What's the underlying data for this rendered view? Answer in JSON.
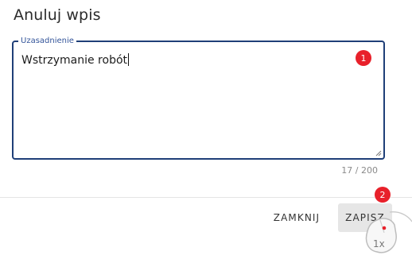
{
  "dialog": {
    "title": "Anuluj wpis"
  },
  "field": {
    "label": "Uzasadnienie",
    "value": "Wstrzymanie robót",
    "counter": "17 / 200"
  },
  "actions": {
    "close_label": "ZAMKNIJ",
    "save_label": "ZAPISZ"
  },
  "annotations": {
    "step1": "1",
    "step2": "2",
    "click_hint": "1x"
  },
  "colors": {
    "field_border": "#1f3f78",
    "label": "#34559a",
    "badge": "#e8202a"
  }
}
